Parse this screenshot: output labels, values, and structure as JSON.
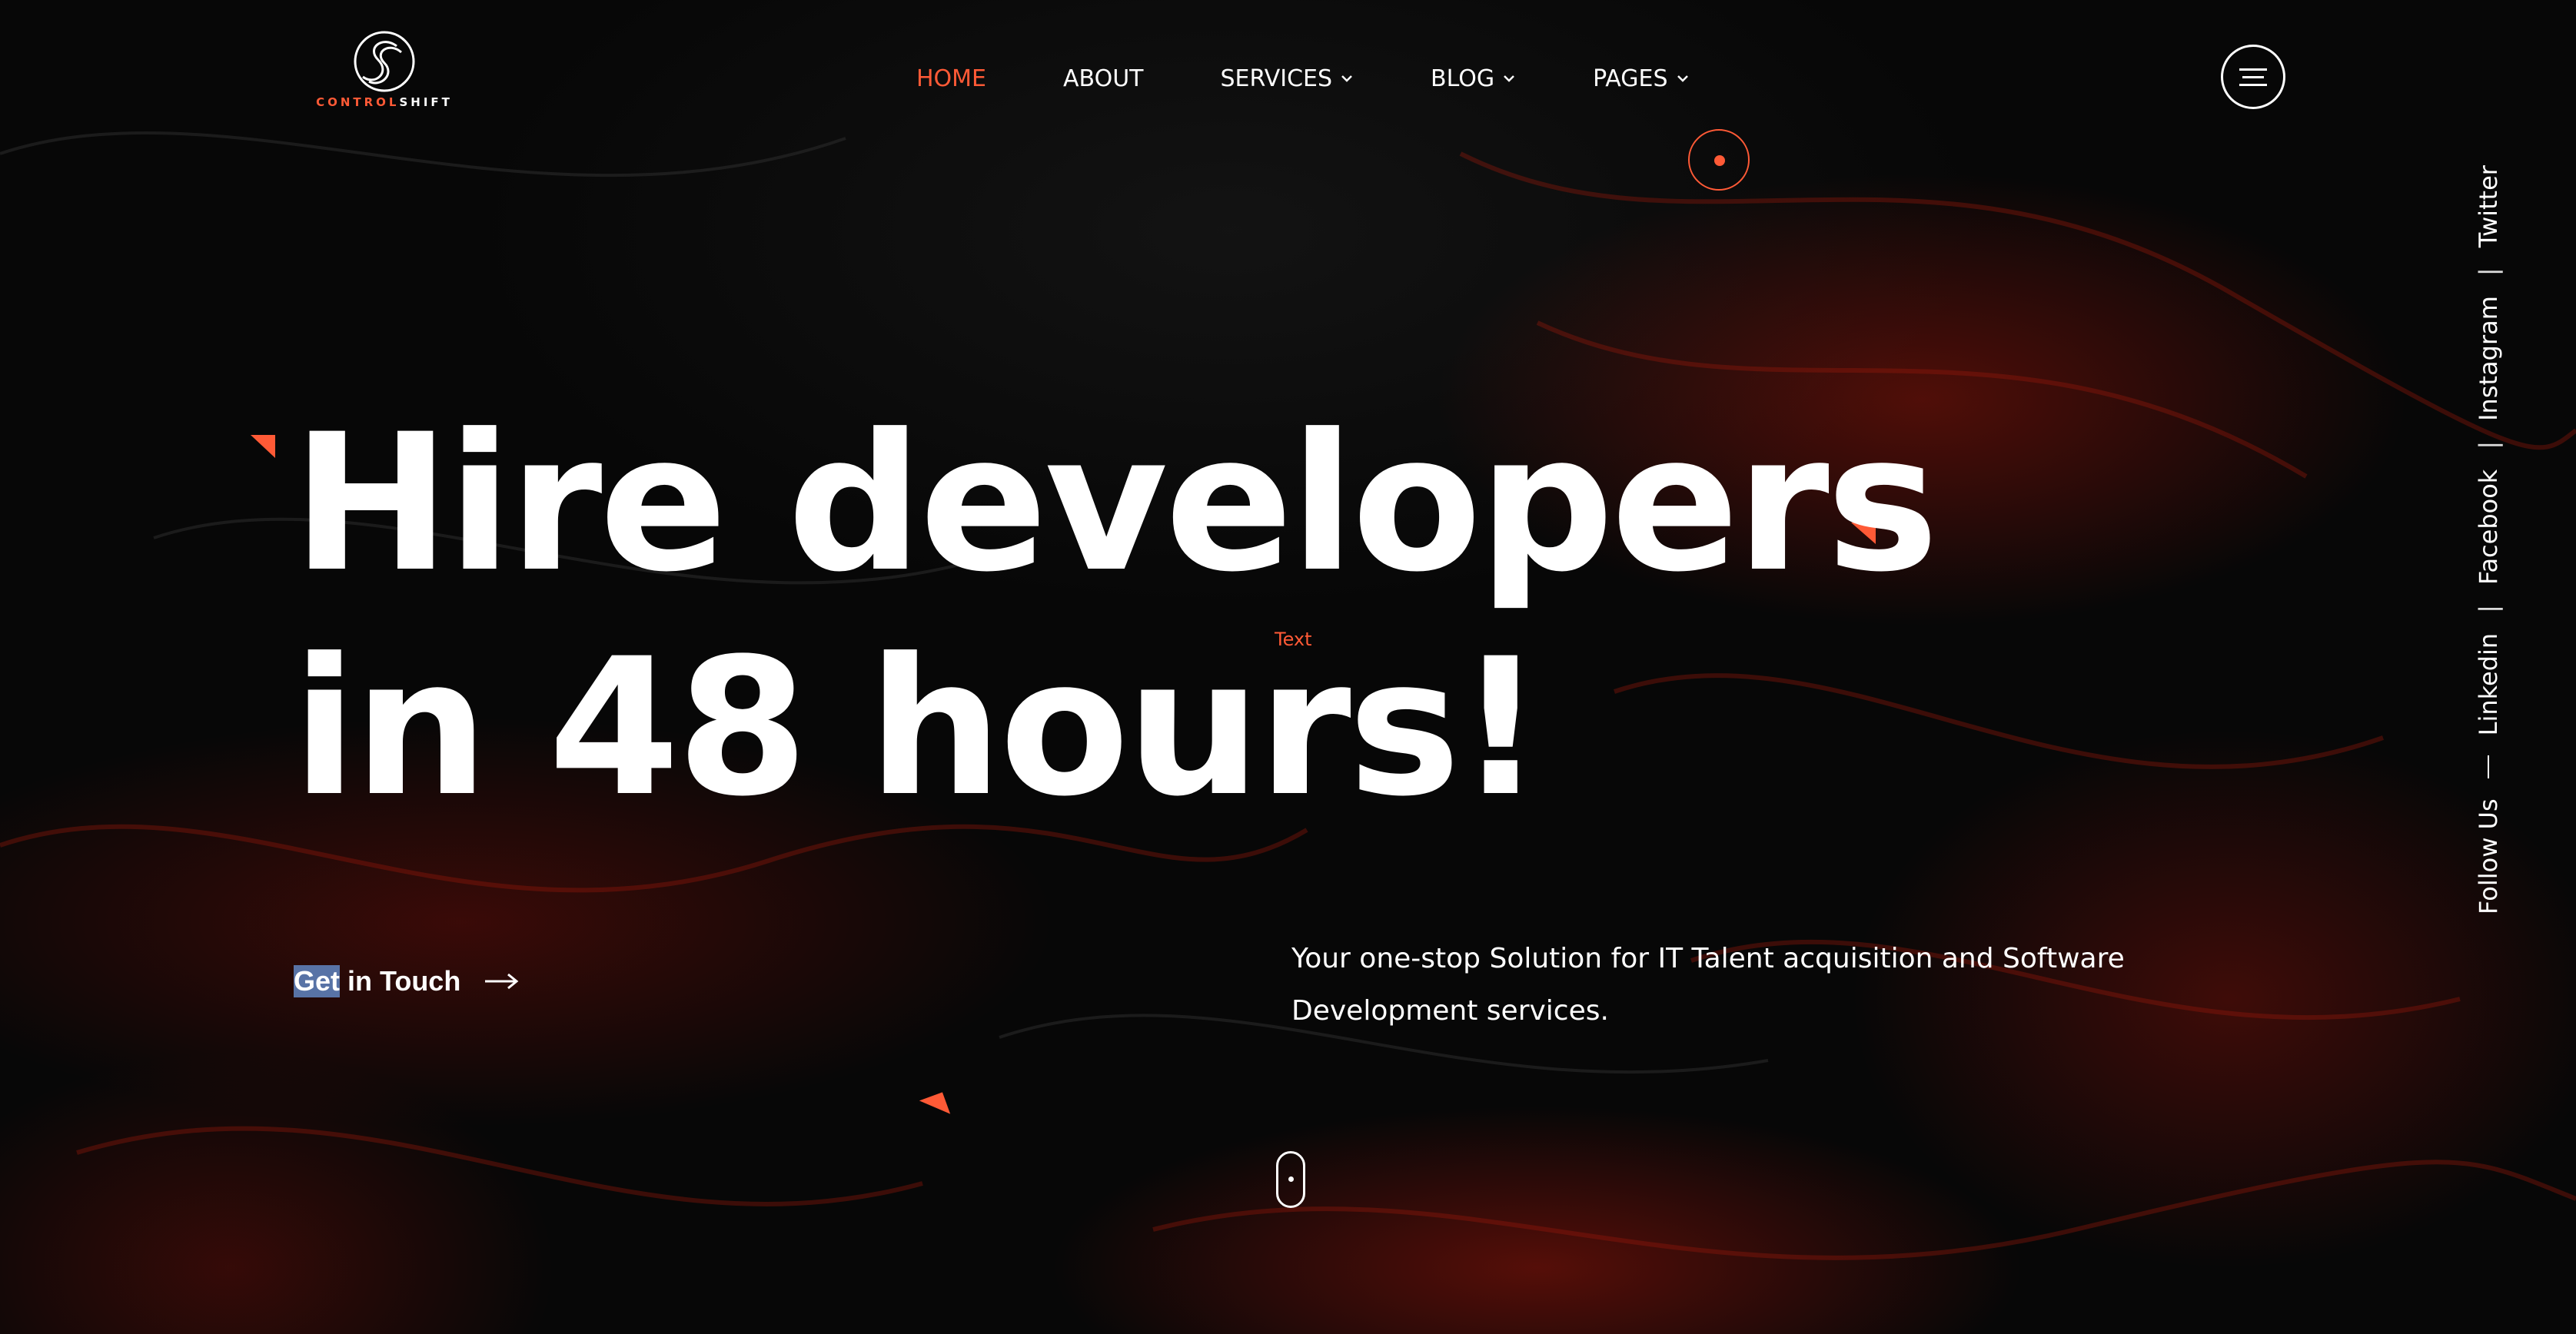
{
  "logo": {
    "word_a": "CONTROL",
    "word_b": "SHIFT"
  },
  "nav": {
    "items": [
      {
        "label": "HOME",
        "active": true,
        "dropdown": false
      },
      {
        "label": "ABOUT",
        "active": false,
        "dropdown": false
      },
      {
        "label": "SERVICES",
        "active": false,
        "dropdown": true
      },
      {
        "label": "BLOG",
        "active": false,
        "dropdown": true
      },
      {
        "label": "PAGES",
        "active": false,
        "dropdown": true
      }
    ]
  },
  "hero": {
    "line1": "Hire developers",
    "line2": "in 48 hours!",
    "tag": "Text",
    "cta_highlight": "Get",
    "cta_rest": " in Touch",
    "tagline": "Your one-stop Solution for IT Talent acquisition and Software Development services."
  },
  "social": {
    "follow": "Follow Us",
    "links": [
      "Linkedin",
      "Facebook",
      "Instagram",
      "Twitter"
    ]
  },
  "colors": {
    "accent": "#ff5a36",
    "background": "#070707",
    "text": "#ffffff"
  }
}
